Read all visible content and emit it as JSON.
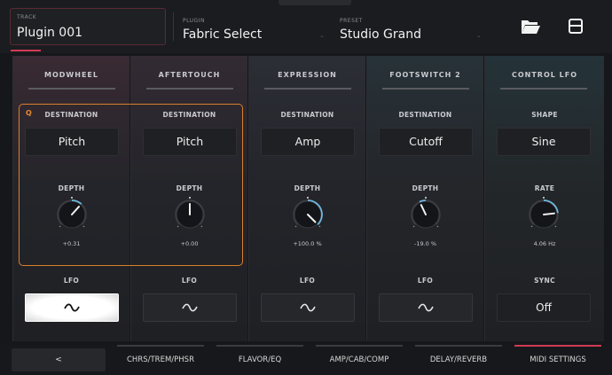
{
  "header": {
    "track_label": "TRACK",
    "track_value": "Plugin 001",
    "plugin_label": "PLUGIN",
    "plugin_value": "Fabric Select",
    "preset_label": "PRESET",
    "preset_value": "Studio Grand"
  },
  "columns": [
    {
      "title": "MODWHEEL",
      "sec1_label": "DESTINATION",
      "sec1_value": "Pitch",
      "sec2_label": "DEPTH",
      "sec2_value": "+0.31",
      "knob_value": 0.31,
      "sec3_label": "LFO"
    },
    {
      "title": "AFTERTOUCH",
      "sec1_label": "DESTINATION",
      "sec1_value": "Pitch",
      "sec2_label": "DEPTH",
      "sec2_value": "+0.00",
      "knob_value": 0.0,
      "sec3_label": "LFO"
    },
    {
      "title": "EXPRESSION",
      "sec1_label": "DESTINATION",
      "sec1_value": "Amp",
      "sec2_label": "DEPTH",
      "sec2_value": "+100.0 %",
      "knob_value": 1.0,
      "sec3_label": "LFO"
    },
    {
      "title": "FOOTSWITCH 2",
      "sec1_label": "DESTINATION",
      "sec1_value": "Cutoff",
      "sec2_label": "DEPTH",
      "sec2_value": "-19.0 %",
      "knob_value": -0.19,
      "sec3_label": "LFO"
    },
    {
      "title": "CONTROL LFO",
      "sec1_label": "SHAPE",
      "sec1_value": "Sine",
      "sec2_label": "RATE",
      "sec2_value": "4.06 Hz",
      "knob_value": 0.62,
      "sec3_label": "SYNC",
      "sec3_value": "Off"
    }
  ],
  "selection_badge": "Q",
  "tabs": {
    "back": "<",
    "items": [
      "CHRS/TREM/PHSR",
      "FLAVOR/EQ",
      "AMP/CAB/COMP",
      "DELAY/REVERB",
      "MIDI SETTINGS"
    ],
    "active": "MIDI SETTINGS"
  },
  "colors": {
    "accent": "#d23a55",
    "selection": "#d9802b",
    "knob_arc": "#6fb6e0"
  }
}
